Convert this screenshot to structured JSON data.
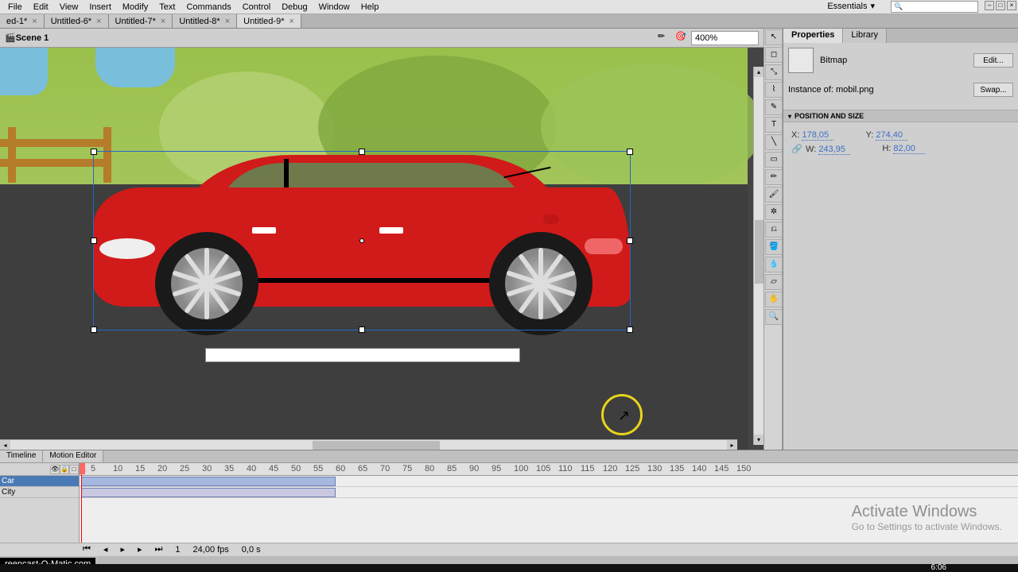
{
  "menu": [
    "File",
    "Edit",
    "View",
    "Insert",
    "Modify",
    "Text",
    "Commands",
    "Control",
    "Debug",
    "Window",
    "Help"
  ],
  "workspace": "Essentials",
  "tabs": [
    {
      "label": "ed-1*",
      "active": false
    },
    {
      "label": "Untitled-6*",
      "active": false
    },
    {
      "label": "Untitled-7*",
      "active": false
    },
    {
      "label": "Untitled-8*",
      "active": false
    },
    {
      "label": "Untitled-9*",
      "active": true
    }
  ],
  "scene": "Scene 1",
  "zoom": "400%",
  "props": {
    "tab_properties": "Properties",
    "tab_library": "Library",
    "type": "Bitmap",
    "edit": "Edit...",
    "swap": "Swap...",
    "instance_label": "Instance of:",
    "instance_name": "mobil.png",
    "section": "POSITION AND SIZE",
    "x_label": "X:",
    "x": "178,05",
    "y_label": "Y:",
    "y": "274,40",
    "w_label": "W:",
    "w": "243,95",
    "h_label": "H:",
    "h": "82,00"
  },
  "timeline": {
    "tab1": "Timeline",
    "tab2": "Motion Editor",
    "layers": [
      "Car",
      "City"
    ],
    "ruler": [
      1,
      5,
      10,
      15,
      20,
      25,
      30,
      35,
      40,
      45,
      50,
      55,
      60,
      65,
      70,
      75,
      80,
      85,
      90,
      95,
      100,
      105,
      110,
      115,
      120,
      125,
      130,
      135,
      140,
      145,
      150
    ],
    "fps": "24,00 fps",
    "time": "0,0 s",
    "frame": "1"
  },
  "watermark": {
    "title": "Activate Windows",
    "sub": "Go to Settings to activate Windows."
  },
  "screencast": "reencast-O-Matic.com",
  "clock": "6:06"
}
